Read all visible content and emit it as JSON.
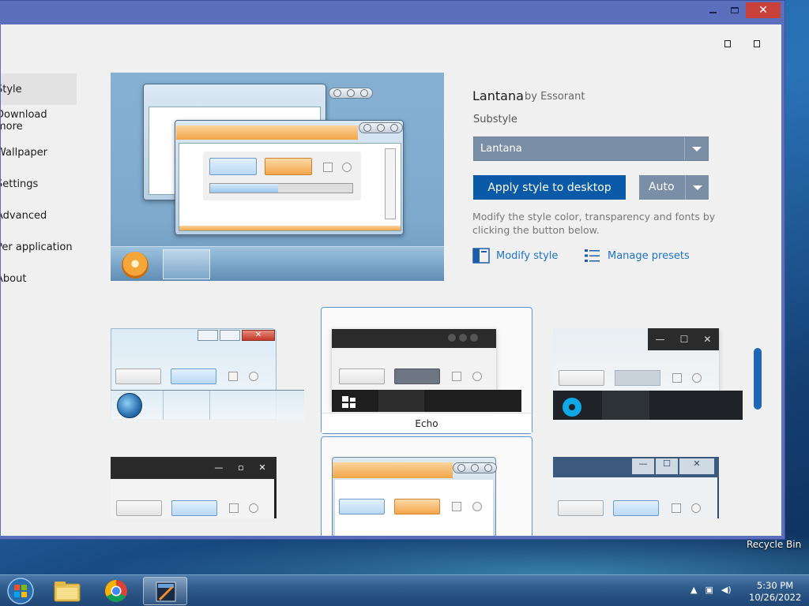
{
  "window": {
    "controls": [
      "minimize",
      "maximize",
      "close"
    ],
    "close_glyph": "✕"
  },
  "sidebar": {
    "items": [
      {
        "label": "Style",
        "active": true
      },
      {
        "label": "Download more"
      },
      {
        "label": "Wallpaper"
      },
      {
        "label": "Settings"
      },
      {
        "label": "Advanced"
      },
      {
        "label": "Per application"
      },
      {
        "label": "About"
      }
    ]
  },
  "details": {
    "name": "Lantana",
    "author": "by Essorant",
    "substyle_label": "Substyle",
    "substyle_value": "Lantana",
    "apply_label": "Apply style to desktop",
    "auto_label": "Auto",
    "description": "Modify the style color, transparency and fonts by clicking the button below.",
    "modify_label": "Modify style",
    "presets_label": "Manage presets"
  },
  "thumbnails": {
    "selected_label": "Echo"
  },
  "desktop": {
    "recycle_bin": "Recycle Bin"
  },
  "taskbar": {
    "time": "5:30 PM",
    "date": "10/26/2022"
  },
  "colors": {
    "accent": "#0b5aa7",
    "link": "#1e73c8",
    "window_frame": "#5b6fbd",
    "close_button": "#c9413b"
  }
}
